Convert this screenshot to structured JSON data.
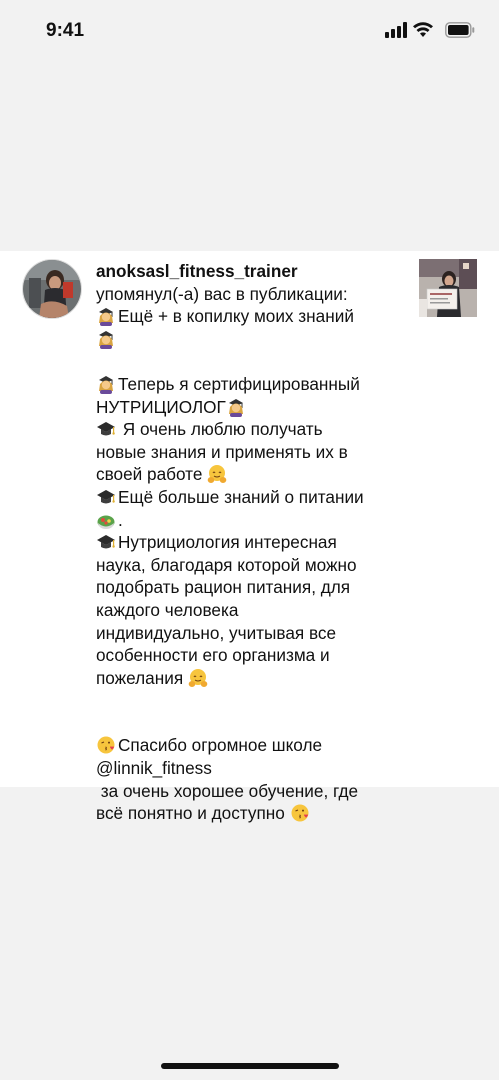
{
  "status_bar": {
    "time": "9:41"
  },
  "notification": {
    "username": "anoksasl_fitness_trainer",
    "action_text": "упомянул(-а) вас в публикации:",
    "lines": [
      {
        "emoji": "teacher",
        "text": "Ещё + в копилку моих знаний"
      },
      {
        "emoji": "teacher",
        "text": ""
      },
      {
        "spacer": true
      },
      {
        "emoji": "teacher",
        "text": "Теперь я сертифицированный"
      },
      {
        "text": "НУТРИЦИОЛОГ",
        "emoji_after": "teacher"
      },
      {
        "emoji": "cap",
        "text": " Я очень люблю получать",
        "lead": " "
      },
      {
        "text": "новые знания и применять их в"
      },
      {
        "text": "своей работе ",
        "emoji_after": "hug"
      },
      {
        "emoji": "cap",
        "text": "Ещё больше знаний о питании"
      },
      {
        "emoji": "salad",
        "text": "."
      },
      {
        "emoji": "cap",
        "text": "Нутрициология интересная"
      },
      {
        "text": "наука, благодаря которой можно"
      },
      {
        "text": "подобрать рацион питания, для"
      },
      {
        "text": "каждого человека"
      },
      {
        "text": "индивидуально, учитывая все"
      },
      {
        "text": "особенности его организма и"
      },
      {
        "text": "пожелания ",
        "emoji_after": "hug"
      },
      {
        "spacer": true
      },
      {
        "spacer": true
      },
      {
        "emoji": "kiss",
        "text": "Спасибо огромное школе"
      },
      {
        "text": "@linnik_fitness"
      },
      {
        "text": " за очень хорошее обучение, где"
      },
      {
        "text": "всё понятно и доступно ",
        "emoji_after": "kiss"
      }
    ]
  }
}
